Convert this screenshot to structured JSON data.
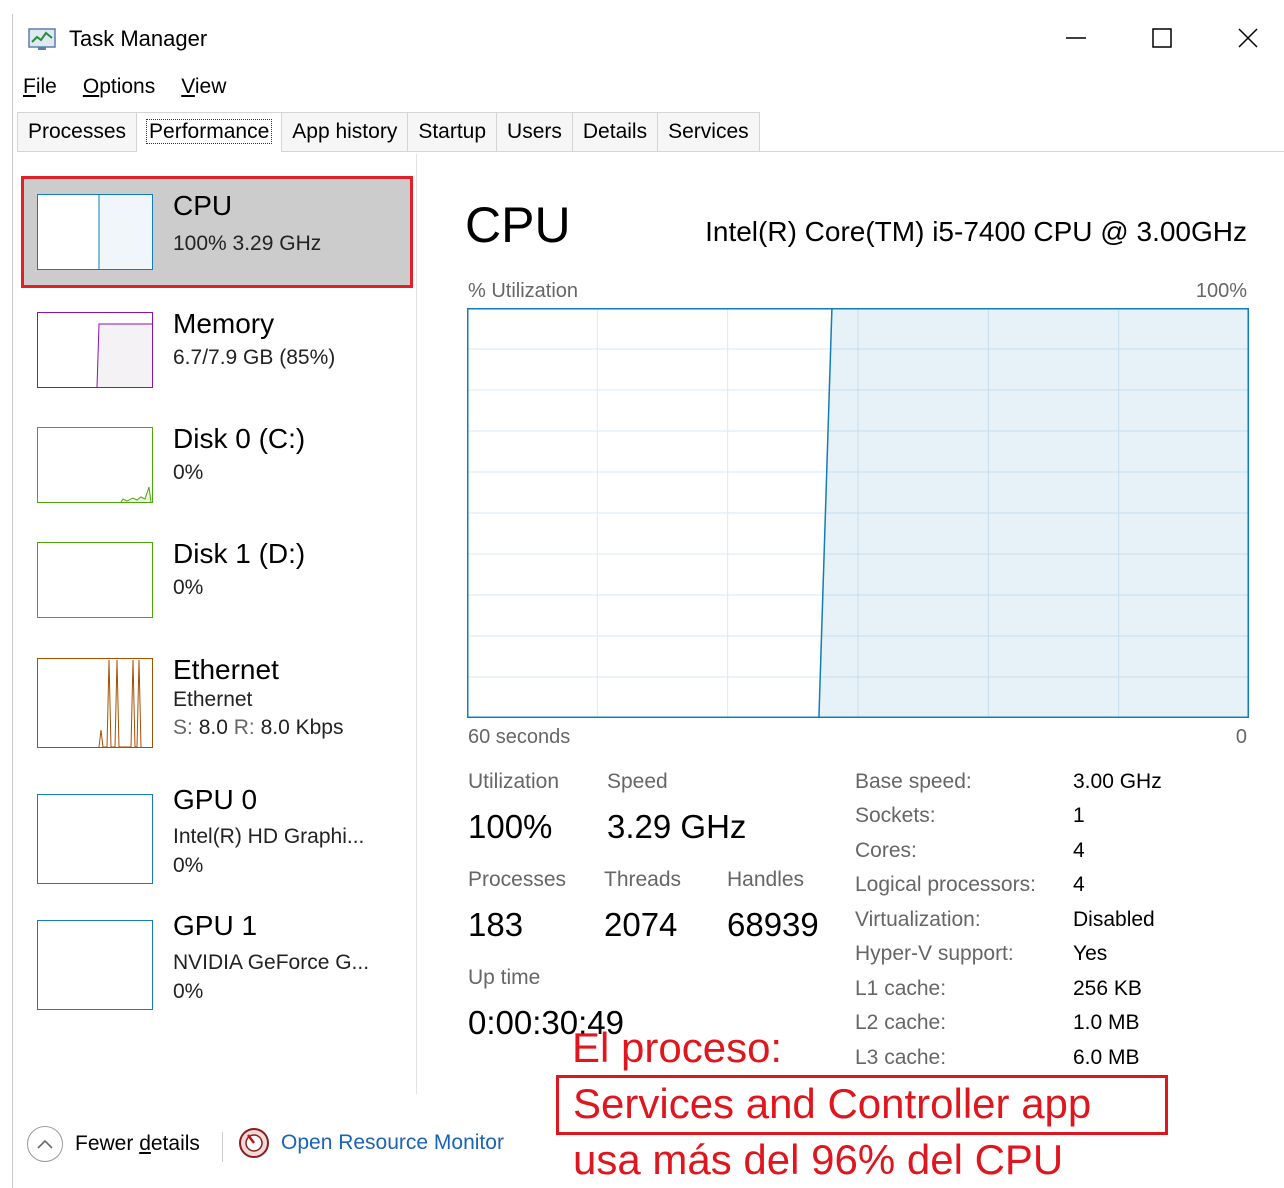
{
  "window": {
    "title": "Task Manager"
  },
  "menu": [
    {
      "accel": "F",
      "rest": "ile"
    },
    {
      "accel": "O",
      "rest": "ptions"
    },
    {
      "accel": "V",
      "rest": "iew"
    }
  ],
  "tabs": [
    "Processes",
    "Performance",
    "App history",
    "Startup",
    "Users",
    "Details",
    "Services"
  ],
  "sidebar": {
    "cpu": {
      "name": "CPU",
      "sub": "100%  3.29 GHz"
    },
    "memory": {
      "name": "Memory",
      "sub": "6.7/7.9 GB (85%)"
    },
    "disk0": {
      "name": "Disk 0 (C:)",
      "sub": "0%"
    },
    "disk1": {
      "name": "Disk 1 (D:)",
      "sub": "0%"
    },
    "ethernet": {
      "name": "Ethernet",
      "sub": "Ethernet",
      "send_label": "S:",
      "send_value": "8.0",
      "recv_label": "R:",
      "recv_value": "8.0 Kbps"
    },
    "gpu0": {
      "name": "GPU 0",
      "sub": "Intel(R) HD Graphi...",
      "usage": "0%"
    },
    "gpu1": {
      "name": "GPU 1",
      "sub": "NVIDIA GeForce G...",
      "usage": "0%"
    }
  },
  "main": {
    "title": "CPU",
    "model": "Intel(R) Core(TM) i5-7400 CPU @ 3.00GHz",
    "util_label": "% Utilization",
    "util_max": "100%",
    "time_label": "60 seconds",
    "time_min": "0",
    "graph_series": {
      "x_seconds_ago": [
        60,
        33,
        32,
        0
      ],
      "utilization_percent": [
        0,
        0,
        100,
        100
      ]
    },
    "stats": {
      "utilization_label": "Utilization",
      "utilization_value": "100%",
      "speed_label": "Speed",
      "speed_value": "3.29 GHz",
      "processes_label": "Processes",
      "processes_value": "183",
      "threads_label": "Threads",
      "threads_value": "2074",
      "handles_label": "Handles",
      "handles_value": "68939",
      "uptime_label": "Up time",
      "uptime_value": "0:00:30:49"
    },
    "specs": [
      {
        "label": "Base speed:",
        "value": "3.00 GHz"
      },
      {
        "label": "Sockets:",
        "value": "1"
      },
      {
        "label": "Cores:",
        "value": "4"
      },
      {
        "label": "Logical processors:",
        "value": "4"
      },
      {
        "label": "Virtualization:",
        "value": "Disabled"
      },
      {
        "label": "Hyper-V support:",
        "value": "Yes"
      },
      {
        "label": "L1 cache:",
        "value": "256 KB"
      },
      {
        "label": "L2 cache:",
        "value": "1.0 MB"
      },
      {
        "label": "L3 cache:",
        "value": "6.0 MB"
      }
    ]
  },
  "footer": {
    "fewer_pre": "Fewer ",
    "fewer_accel": "d",
    "fewer_rest": "etails",
    "resource_monitor": "Open Resource Monitor"
  },
  "annotation": {
    "line1": "El proceso:",
    "line2": "Services and Controller app",
    "line3": "usa más del 96% del CPU"
  },
  "colors": {
    "cpu": "#117dbb",
    "memory": "#8b12ae",
    "disk": "#4da60c",
    "ethernet": "#a74f01",
    "gpu": "#117dbb",
    "highlight": "#e0161e"
  }
}
